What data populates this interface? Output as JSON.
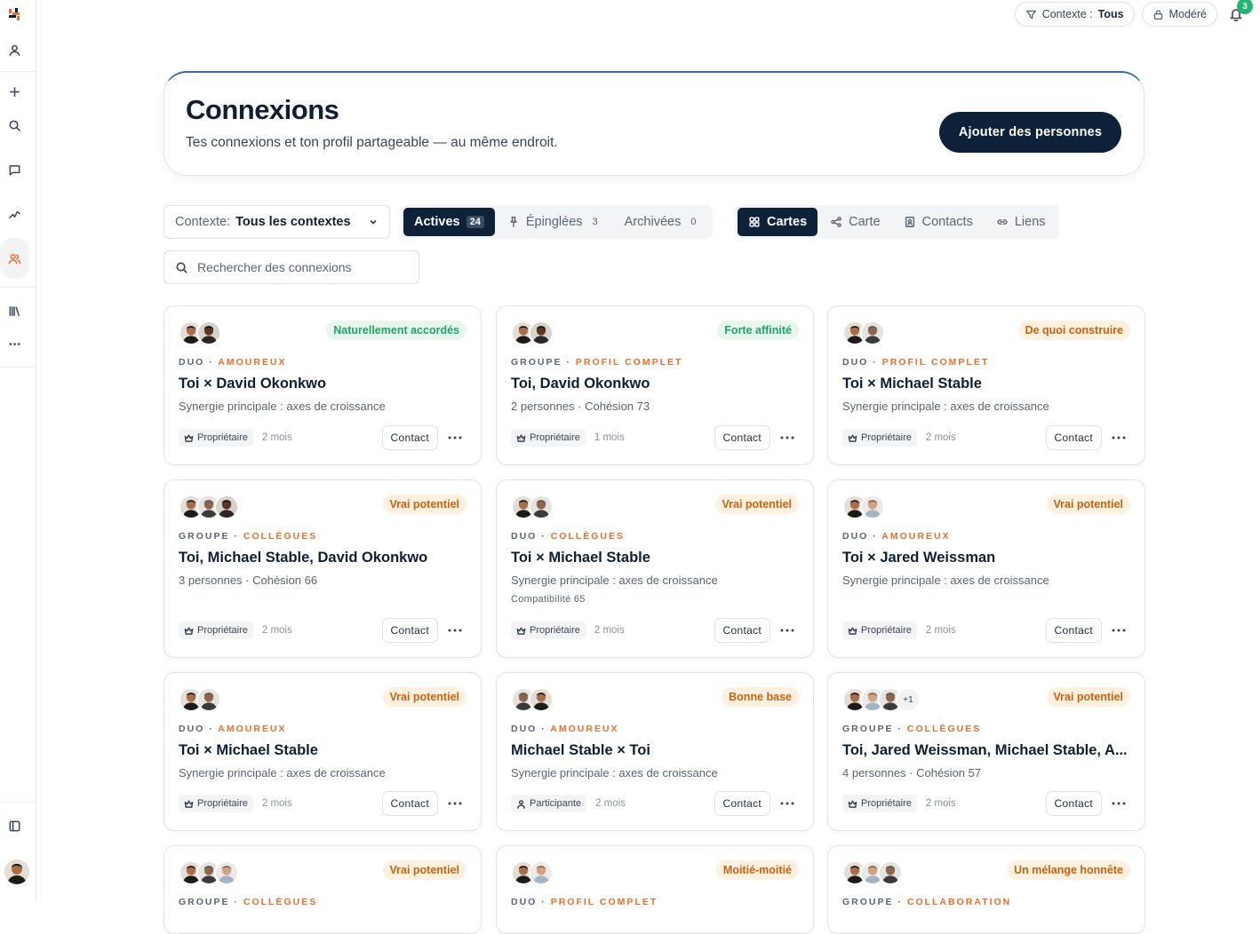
{
  "topbar": {
    "context_label": "Contexte :",
    "context_value": "Tous",
    "mode_label": "Modéré",
    "notifications_count": "3"
  },
  "hero": {
    "title": "Connexions",
    "subtitle": "Tes connexions et ton profil partageable — au même endroit.",
    "add_button": "Ajouter des personnes"
  },
  "filters": {
    "context_label": "Contexte:",
    "context_value": "Tous les contextes",
    "status_tabs": [
      {
        "label": "Actives",
        "count": "24",
        "active": true
      },
      {
        "label": "Épinglées",
        "count": "3",
        "active": false
      },
      {
        "label": "Archivées",
        "count": "0",
        "active": false
      }
    ],
    "view_tabs": [
      {
        "label": "Cartes",
        "icon": "grid-icon",
        "active": true
      },
      {
        "label": "Carte",
        "icon": "share-nodes-icon",
        "active": false
      },
      {
        "label": "Contacts",
        "icon": "contact-card-icon",
        "active": false
      },
      {
        "label": "Liens",
        "icon": "link-icon",
        "active": false
      }
    ],
    "search_placeholder": "Rechercher des connexions"
  },
  "cards": [
    {
      "badge": "Naturellement accordés",
      "kind": "DUO",
      "category": "AMOUREUX",
      "title": "Toi × David Okonkwo",
      "subtitle": "Synergie principale : axes de croissance",
      "role": "Propriétaire",
      "ago": "2 mois",
      "contact": "Contact"
    },
    {
      "badge": "Forte affinité",
      "kind": "GROUPE",
      "category": "PROFIL COMPLET",
      "title": "Toi, David Okonkwo",
      "subtitle": "2 personnes · Cohésion 73",
      "role": "Propriétaire",
      "ago": "1 mois",
      "contact": "Contact"
    },
    {
      "badge": "De quoi construire",
      "kind": "DUO",
      "category": "PROFIL COMPLET",
      "title": "Toi × Michael Stable",
      "subtitle": "Synergie principale : axes de croissance",
      "role": "Propriétaire",
      "ago": "2 mois",
      "contact": "Contact"
    },
    {
      "badge": "Vrai potentiel",
      "kind": "GROUPE",
      "category": "COLLÈGUES",
      "title": "Toi, Michael Stable, David Okonkwo",
      "subtitle": "3 personnes · Cohésion 66",
      "role": "Propriétaire",
      "ago": "2 mois",
      "contact": "Contact"
    },
    {
      "badge": "Vrai potentiel",
      "kind": "DUO",
      "category": "COLLÈGUES",
      "title": "Toi × Michael Stable",
      "subtitle": "Synergie principale : axes de croissance",
      "extra": "Compatibilité 65",
      "role": "Propriétaire",
      "ago": "2 mois",
      "contact": "Contact"
    },
    {
      "badge": "Vrai potentiel",
      "kind": "DUO",
      "category": "AMOUREUX",
      "title": "Toi × Jared Weissman",
      "subtitle": "Synergie principale : axes de croissance",
      "role": "Propriétaire",
      "ago": "2 mois",
      "contact": "Contact"
    },
    {
      "badge": "Vrai potentiel",
      "kind": "DUO",
      "category": "AMOUREUX",
      "title": "Toi × Michael Stable",
      "subtitle": "Synergie principale : axes de croissance",
      "role": "Propriétaire",
      "ago": "2 mois",
      "contact": "Contact"
    },
    {
      "badge": "Bonne base",
      "kind": "DUO",
      "category": "AMOUREUX",
      "title": "Michael Stable × Toi",
      "subtitle": "Synergie principale : axes de croissance",
      "role": "Participante",
      "ago": "2 mois",
      "contact": "Contact"
    },
    {
      "badge": "Vrai potentiel",
      "kind": "GROUPE",
      "category": "COLLÈGUES",
      "title": "Toi, Jared Weissman, Michael Stable, A...",
      "subtitle": "4 personnes · Cohésion 57",
      "more_avatars": "+1",
      "role": "Propriétaire",
      "ago": "2 mois",
      "contact": "Contact"
    },
    {
      "badge": "Vrai potentiel",
      "kind": "GROUPE",
      "category": "COLLÈGUES"
    },
    {
      "badge": "Moitié-moitié",
      "kind": "DUO",
      "category": "PROFIL COMPLET"
    },
    {
      "badge": "Un mélange honnête",
      "kind": "GROUPE",
      "category": "COLLABORATION"
    }
  ]
}
